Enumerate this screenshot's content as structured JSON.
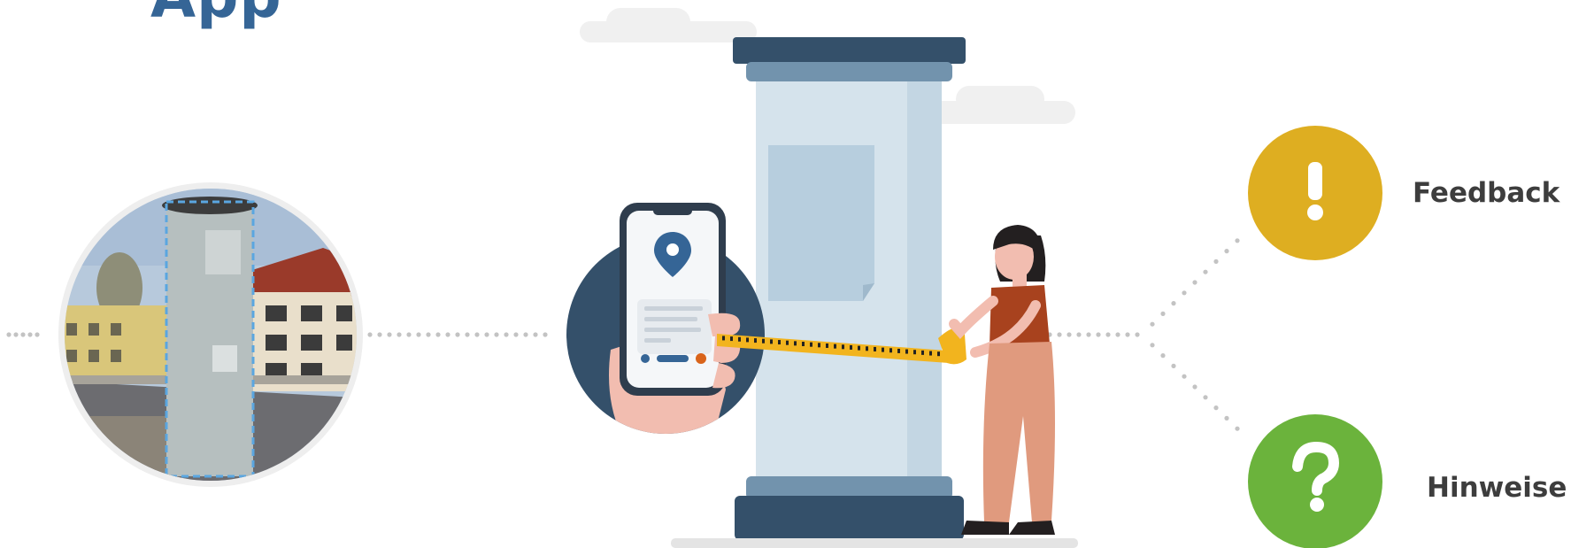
{
  "title": "App",
  "phone_screen": {
    "pin_icon": "location-pin-icon",
    "pin_color": "#356596"
  },
  "outcomes": [
    {
      "label": "Feedback",
      "icon": "exclamation-icon",
      "symbol": "!",
      "color": "#DEAE21"
    },
    {
      "label": "Hinweise",
      "icon": "question-mark-icon",
      "symbol": "?",
      "color": "#6BB33C"
    }
  ],
  "colors": {
    "title": "#356596",
    "column_body": "#D5E3EC",
    "column_cap": "#34506A",
    "hand_circle": "#34506A",
    "measuring_tape": "#F2B41E",
    "person_pants": "#E09A7E",
    "person_shirt": "#A8421E"
  }
}
